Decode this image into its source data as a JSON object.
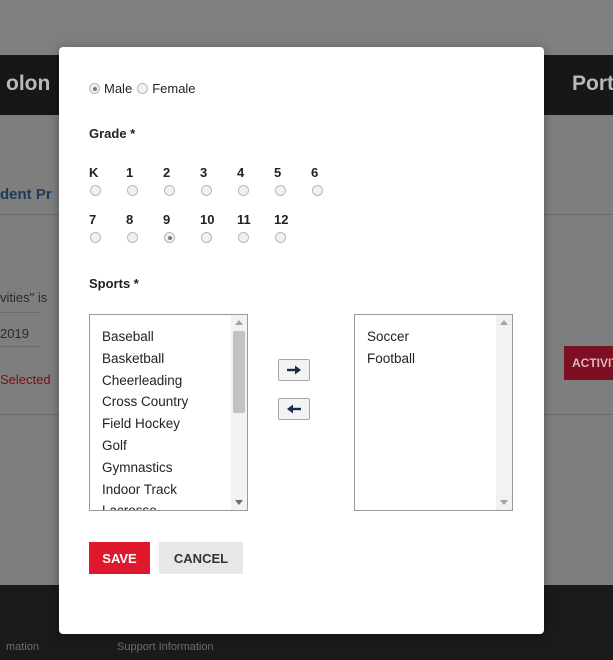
{
  "background": {
    "title_left": "olon",
    "title_right": "Portal",
    "subheading": "dent Pr",
    "text_activities": "vities\" is",
    "text_year": "2019",
    "text_selected": "Selected",
    "activities_button": "ACTIVITIES",
    "footer_left": "mation",
    "footer_support": "Support Information"
  },
  "modal": {
    "gender": {
      "male": "Male",
      "female": "Female",
      "selected": "Male"
    },
    "grade_label": "Grade *",
    "grades_row1": [
      "K",
      "1",
      "2",
      "3",
      "4",
      "5",
      "6"
    ],
    "grades_row2": [
      "7",
      "8",
      "9",
      "10",
      "11",
      "12"
    ],
    "selected_grade": "9",
    "sports_label": "Sports *",
    "available_sports": [
      "Baseball",
      "Basketball",
      "Cheerleading",
      "Cross Country",
      "Field Hockey",
      "Golf",
      "Gymnastics",
      "Indoor Track",
      "Lacrosse"
    ],
    "selected_sports": [
      "Soccer",
      "Football"
    ],
    "save_label": "SAVE",
    "cancel_label": "CANCEL"
  },
  "colors": {
    "save": "#e0182d",
    "cancel": "#e7e7e7",
    "overlay": "#7f7f7f",
    "activities": "#7d0f22"
  }
}
